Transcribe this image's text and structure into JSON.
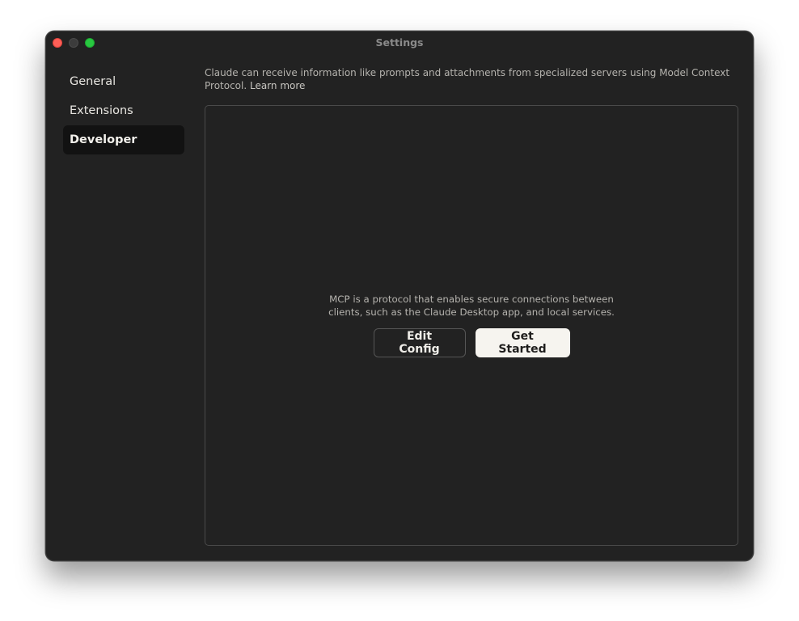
{
  "window": {
    "title": "Settings"
  },
  "sidebar": {
    "items": [
      {
        "label": "General"
      },
      {
        "label": "Extensions"
      },
      {
        "label": "Developer"
      }
    ]
  },
  "main": {
    "description": "Claude can receive information like prompts and attachments from specialized servers using Model Context Protocol.",
    "learn_more": "Learn more",
    "empty_state": {
      "text": "MCP is a protocol that enables secure connections between clients, such as the Claude Desktop app, and local services.",
      "edit_config_label": "Edit Config",
      "get_started_label": "Get Started"
    }
  },
  "colors": {
    "window_bg": "#222222",
    "active_nav_bg": "#121212",
    "primary_button_bg": "#f6f4ef",
    "close": "#fe5f57",
    "maximize": "#28c840"
  }
}
